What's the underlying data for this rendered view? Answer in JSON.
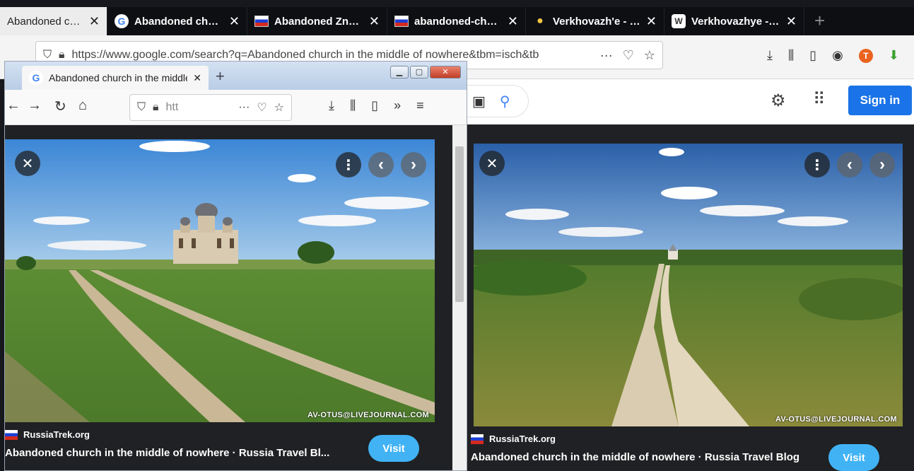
{
  "back_browser": {
    "tabs": [
      {
        "title": "Abandoned church i",
        "favicon": "google-icon",
        "active": true
      },
      {
        "title": "Abandoned church i",
        "favicon": "google-icon",
        "active": false
      },
      {
        "title": "Abandoned Znamen",
        "favicon": "russian-flag-icon",
        "active": false
      },
      {
        "title": "abandoned-church-",
        "favicon": "russian-flag-icon",
        "active": false
      },
      {
        "title": "Verkhovazh'e - Goo",
        "favicon": "maps-pin-icon",
        "active": false
      },
      {
        "title": "Verkhovazhye - Wiki",
        "favicon": "wikipedia-icon",
        "active": false
      }
    ],
    "url": "https://www.google.com/search?q=Abandoned church in the middle of nowhere&tbm=isch&tb",
    "sign_in_label": "Sign in"
  },
  "front_browser": {
    "tab_title": "Abandoned church in the middle",
    "url": "htt"
  },
  "left_result": {
    "source": "RussiaTrek.org",
    "title": "Abandoned church in the middle of nowhere · Russia Travel Bl...",
    "visit_label": "Visit",
    "watermark": "AV-OTUS@LIVEJOURNAL.COM"
  },
  "right_result": {
    "source": "RussiaTrek.org",
    "title": "Abandoned church in the middle of nowhere · Russia Travel Blog",
    "visit_label": "Visit",
    "watermark": "AV-OTUS@LIVEJOURNAL.COM"
  },
  "icons": {
    "close": "✕",
    "more": "⋮",
    "prev": "‹",
    "next": "›"
  },
  "colors": {
    "sign_in_blue": "#1a73e8",
    "visit_blue": "#41b3f5",
    "dark_panel": "#202124"
  }
}
